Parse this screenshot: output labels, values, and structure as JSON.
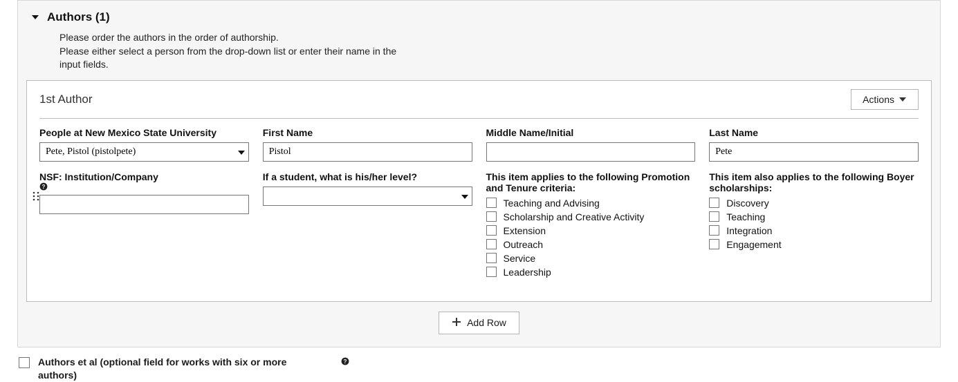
{
  "panel": {
    "title": "Authors (1)",
    "instructions_line1": "Please order the authors in the order of authorship.",
    "instructions_line2": "Please either select a person from the drop-down list or enter their name in the input fields."
  },
  "author": {
    "heading": "1st Author",
    "actions_label": "Actions",
    "fields": {
      "people_label": "People at New Mexico State University",
      "people_value": "Pete, Pistol (pistolpete)",
      "first_name_label": "First Name",
      "first_name_value": "Pistol",
      "middle_name_label": "Middle Name/Initial",
      "middle_name_value": "",
      "last_name_label": "Last Name",
      "last_name_value": "Pete",
      "nsf_label": "NSF: Institution/Company",
      "nsf_value": "",
      "student_level_label": "If a student, what is his/her level?",
      "student_level_value": "",
      "pt_label": "This item applies to the following Promotion and Tenure criteria:",
      "boyer_label": "This item also applies to the following Boyer scholarships:"
    },
    "pt_options": [
      "Teaching and Advising",
      "Scholarship and Creative Activity",
      "Extension",
      "Outreach",
      "Service",
      "Leadership"
    ],
    "boyer_options": [
      "Discovery",
      "Teaching",
      "Integration",
      "Engagement"
    ]
  },
  "add_row_label": "Add Row",
  "etal": {
    "label": "Authors et al (optional field for works with six or more authors)"
  }
}
